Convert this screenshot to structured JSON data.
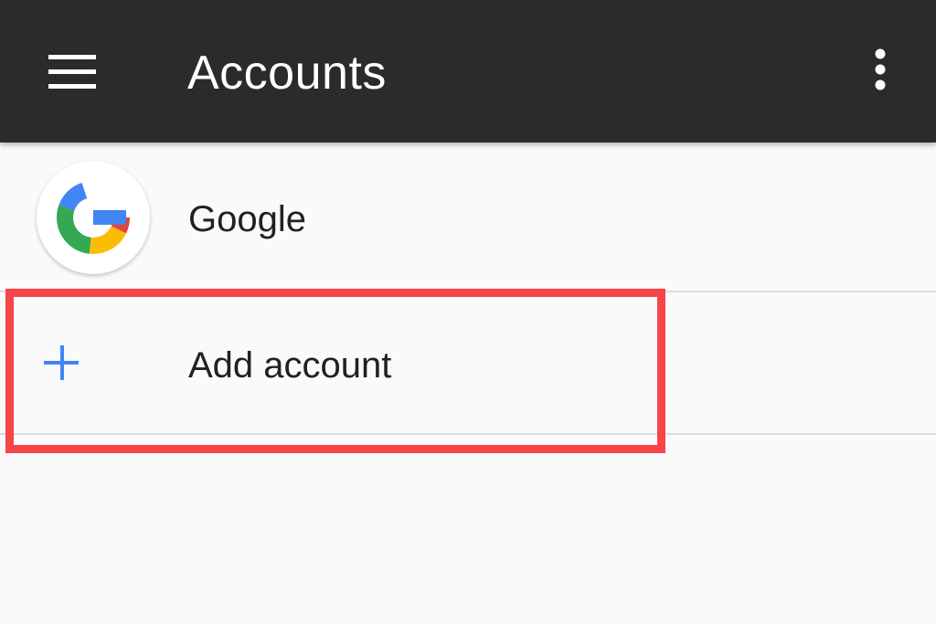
{
  "toolbar": {
    "title": "Accounts",
    "menu_icon": "hamburger-menu-icon",
    "overflow_icon": "more-vert-icon",
    "background_color": "#2b2b2b"
  },
  "accounts": [
    {
      "label": "Google",
      "icon": "google-logo-icon"
    }
  ],
  "add_account": {
    "label": "Add account",
    "icon": "plus-icon",
    "icon_color": "#4285f4"
  },
  "annotation": {
    "highlight_color": "#f7454a",
    "target": "add-account-row"
  }
}
